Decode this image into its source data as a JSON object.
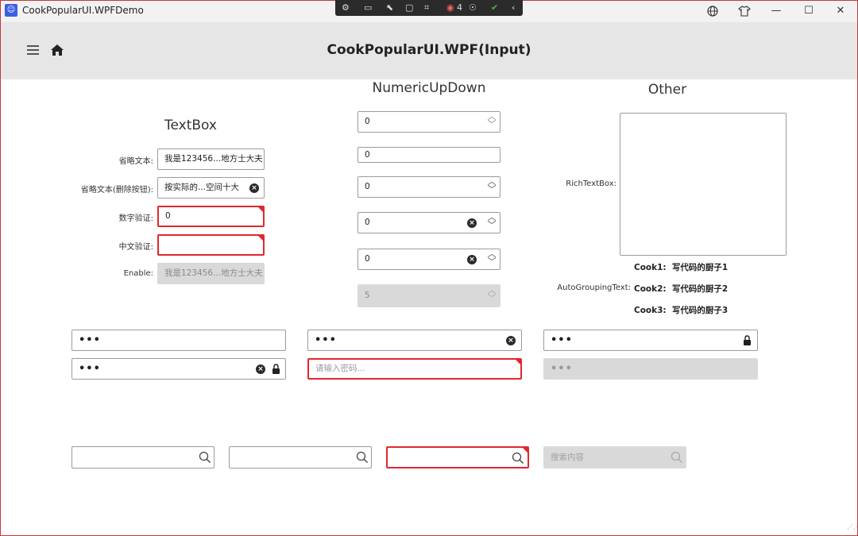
{
  "window": {
    "title": "CookPopularUI.WPFDemo",
    "devbar_badge": "4"
  },
  "header": {
    "page_title": "CookPopularUI.WPF(Input)"
  },
  "textbox_section": {
    "title": "TextBox",
    "rows": [
      {
        "label": "省略文本:",
        "value": "我是123456...地方士大夫"
      },
      {
        "label": "省略文本(删除按钮):",
        "value": "按实际的...空间十大"
      },
      {
        "label": "数字验证:",
        "value": "0"
      },
      {
        "label": "中文验证:",
        "value": ""
      },
      {
        "label": "Enable:",
        "value": "我是123456...地方士大夫"
      }
    ]
  },
  "numeric_section": {
    "title": "NumericUpDown",
    "values": [
      "0",
      "0",
      "0",
      "0",
      "0",
      "5"
    ]
  },
  "other_section": {
    "title": "Other",
    "richtextbox_label": "RichTextBox:",
    "autogrouping_label": "AutoGroupingText:",
    "groups": [
      {
        "key": "Cook1:",
        "value": "写代码的厨子1"
      },
      {
        "key": "Cook2:",
        "value": "写代码的厨子2"
      },
      {
        "key": "Cook3:",
        "value": "写代码的厨子3"
      }
    ]
  },
  "passwords": {
    "masked": "•••",
    "placeholder": "请输入密码..."
  },
  "search": {
    "disabled_placeholder": "搜索内容"
  },
  "colors": {
    "error": "#e0282e",
    "header_bg": "#e6e6e6",
    "window_border": "#c8373c"
  }
}
